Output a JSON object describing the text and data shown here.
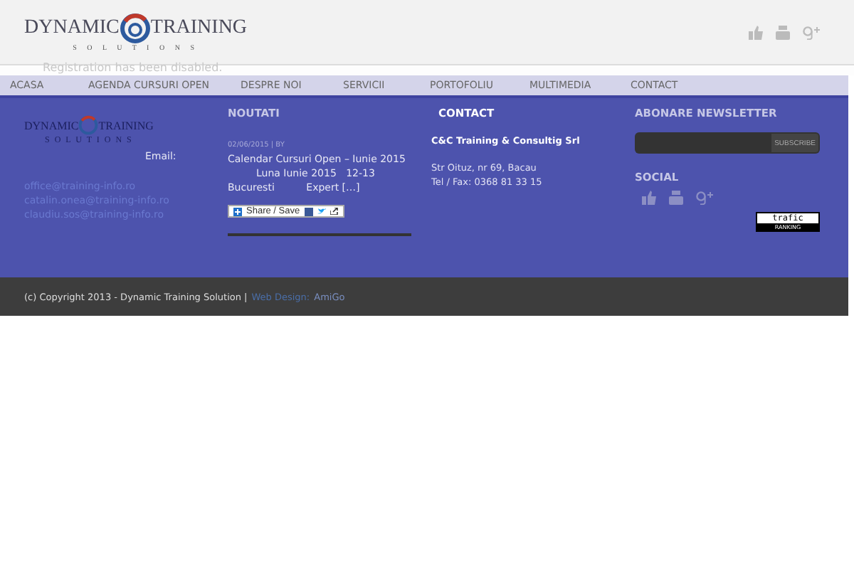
{
  "header": {
    "logo": {
      "word_left": "DYNAMIC",
      "word_right": "TRAINING",
      "tagline": "S O L U T I O N S"
    }
  },
  "notice": "Registration has been disabled.",
  "nav": [
    {
      "label": "ACASA",
      "selected": false
    },
    {
      "label": "AGENDA CURSURI OPEN",
      "selected": false
    },
    {
      "label": "DESPRE NOI",
      "selected": false
    },
    {
      "label": "SERVICII",
      "selected": false
    },
    {
      "label": "PORTOFOLIU",
      "selected": false
    },
    {
      "label": "MULTIMEDIA",
      "selected": false
    },
    {
      "label": "CONTACT",
      "selected": false
    }
  ],
  "footer": {
    "about": {
      "logo": {
        "word_left": "DYNAMIC",
        "word_right": "TRAINING",
        "tagline": "S O L U T I O N S"
      },
      "email_label": "Email:",
      "emails": [
        "office@training-info.ro",
        "catalin.onea@training-info.ro",
        "claudiu.sos@training-info.ro"
      ]
    },
    "news": {
      "title": "NOUTATI",
      "meta": "02/06/2015 | BY",
      "link": "Calendar Cursuri Open – Iunie 2015",
      "lines": [
        "Luna Iunie 2015   12-13",
        "Bucuresti          Expert […]"
      ],
      "share": "Share / Save"
    },
    "contact": {
      "title": "CONTACT",
      "company": "C&C Training & Consultig Srl",
      "address": "Str Oituz, nr 69, Bacau",
      "phone": "Tel / Fax: 0368 81 33 15"
    },
    "newsletter": {
      "title": "ABONARE NEWSLETTER",
      "button": "SUBSCRIBE",
      "social_title": "SOCIAL",
      "badge_top": "trafic",
      "badge_bottom": "RANKING"
    }
  },
  "bottom": {
    "copyright": "(c) Copyright 2013 - Dynamic Training Solution |",
    "design_label": "Web Design:",
    "designer": "AmiGo"
  }
}
